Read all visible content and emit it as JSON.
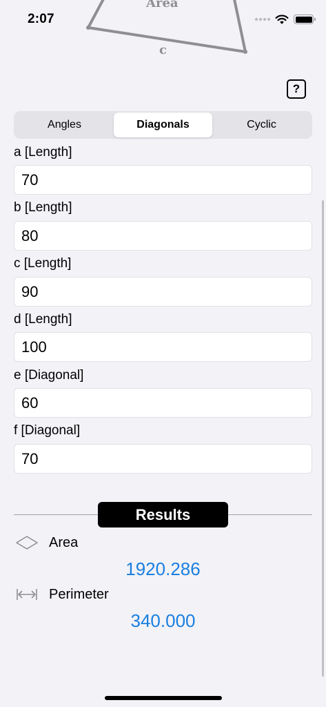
{
  "status_bar": {
    "time": "2:07"
  },
  "figure": {
    "area_label": "Area",
    "side_label": "c"
  },
  "help_button": "?",
  "segments": [
    {
      "label": "Angles",
      "selected": false
    },
    {
      "label": "Diagonals",
      "selected": true
    },
    {
      "label": "Cyclic",
      "selected": false
    }
  ],
  "fields": {
    "a": {
      "label": "a [Length]",
      "value": "70"
    },
    "b": {
      "label": "b [Length]",
      "value": "80"
    },
    "c": {
      "label": "c [Length]",
      "value": "90"
    },
    "d": {
      "label": "d [Length]",
      "value": "100"
    },
    "e": {
      "label": "e [Diagonal]",
      "value": "60"
    },
    "f": {
      "label": "f [Diagonal]",
      "value": "70"
    }
  },
  "results": {
    "heading": "Results",
    "area": {
      "label": "Area",
      "value": "1920.286",
      "icon": "diamond-icon"
    },
    "perimeter": {
      "label": "Perimeter",
      "value": "340.000",
      "icon": "horizontal-measure-icon"
    }
  },
  "colors": {
    "accent": "#1a7fe0",
    "background": "#f2f2f7"
  }
}
